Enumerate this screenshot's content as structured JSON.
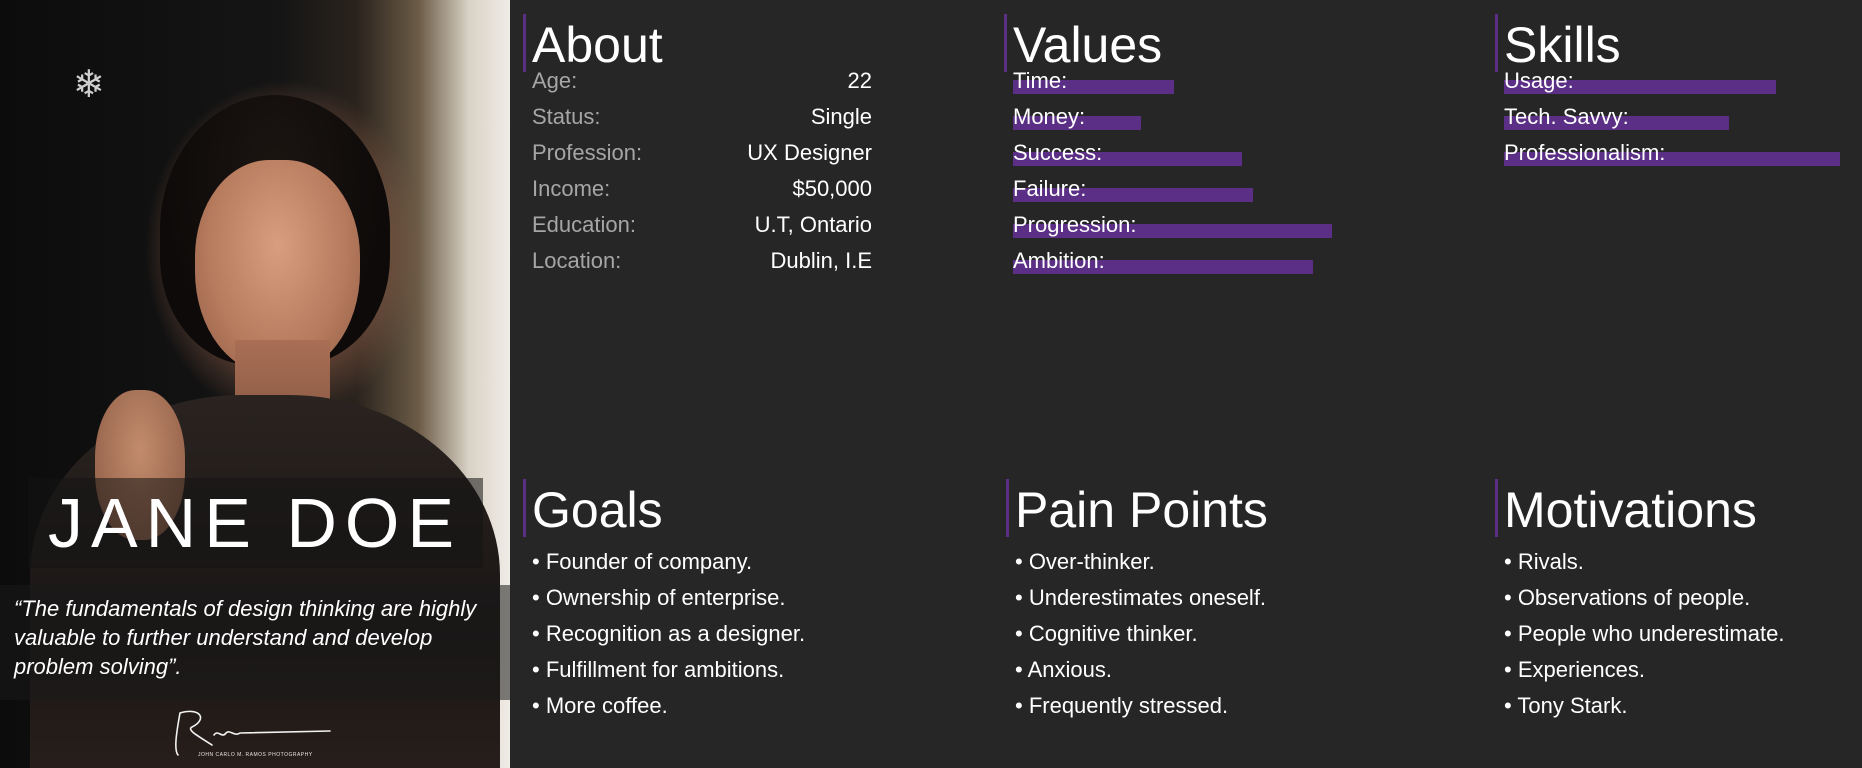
{
  "persona": {
    "name": "JANE DOE",
    "quote": "“The fundamentals of design thinking are highly valuable to further understand and develop problem solving”.",
    "photo_credit": "JOHN CARLO M. RAMOS PHOTOGRAPHY"
  },
  "about": {
    "title": "About",
    "rows": [
      {
        "label": "Age:",
        "value": "22"
      },
      {
        "label": "Status:",
        "value": "Single"
      },
      {
        "label": "Profession:",
        "value": "UX Designer"
      },
      {
        "label": "Income:",
        "value": "$50,000"
      },
      {
        "label": "Education:",
        "value": "U.T, Ontario"
      },
      {
        "label": "Location:",
        "value": "Dublin, I.E"
      }
    ]
  },
  "values": {
    "title": "Values",
    "items": [
      {
        "label": "Time:",
        "level": 0.59
      },
      {
        "label": "Money:",
        "level": 0.47
      },
      {
        "label": "Success:",
        "level": 0.84
      },
      {
        "label": "Failure:",
        "level": 0.88
      },
      {
        "label": "Progression:",
        "level": 1.17
      },
      {
        "label": "Ambition:",
        "level": 1.1
      }
    ]
  },
  "skills": {
    "title": "Skills",
    "items": [
      {
        "label": "Usage:",
        "level": 0.81
      },
      {
        "label": "Tech. Savvy:",
        "level": 0.67
      },
      {
        "label": "Professionalism:",
        "level": 1.0
      }
    ]
  },
  "goals": {
    "title": "Goals",
    "items": [
      "• Founder of company.",
      "• Ownership of enterprise.",
      "• Recognition as a designer.",
      "• Fulfillment for ambitions.",
      "• More coffee."
    ]
  },
  "pain_points": {
    "title": "Pain Points",
    "items": [
      "• Over-thinker.",
      "• Underestimates oneself.",
      "• Cognitive thinker.",
      "• Anxious.",
      "• Frequently stressed."
    ]
  },
  "motivations": {
    "title": "Motivations",
    "items": [
      "• Rivals.",
      "• Observations of people.",
      "• People who underestimate.",
      "• Experiences.",
      "• Tony Stark."
    ]
  },
  "colors": {
    "background": "#262626",
    "accent": "#5c2f86",
    "label_gray": "#a6a6a6",
    "text": "#ffffff"
  },
  "icons": {
    "snowflake": "snowflake-icon",
    "signature": "signature-icon"
  }
}
